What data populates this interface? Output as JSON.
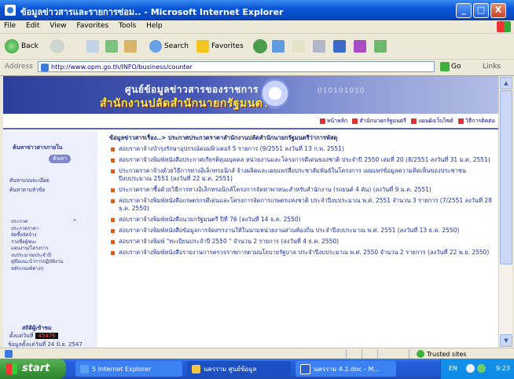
{
  "window": {
    "title": "ข้อมูลข่าวสารและรายการซ่อม.. - Microsoft Internet Explorer",
    "controls": [
      "_",
      "□",
      "X"
    ]
  },
  "menu": [
    "File",
    "Edit",
    "View",
    "Favorites",
    "Tools",
    "Help"
  ],
  "toolbar": {
    "back": "Back",
    "search": "Search",
    "favorites": "Favorites"
  },
  "address": {
    "label": "Address",
    "url": "http://www.opm.go.th/INFO/business/counter",
    "go": "Go",
    "links": "Links"
  },
  "banner": {
    "org_line1": "ศูนย์ข้อมูลข่าวสารของราชการ",
    "org_line2": "สำนักงานปลัดสำนักนายกรัฐมนตรี",
    "decor_text": "010101010"
  },
  "nav_links": [
    "หน้าหลัก",
    "สำนักนายกรัฐมนตรี",
    "แผนผังเว็บไซต์",
    "วิธีการติดต่อ"
  ],
  "sidebar": {
    "search_title": "ค้นหาข่าวสารภายใน",
    "search_button": "ค้นหา",
    "link1": "ค้นหาแบบละเอียด",
    "link2": "ค้นหาตามหัวข้อ",
    "menu": [
      "ประกาศ",
      "ประกวดราคา",
      "จัดซื้อจัดจ้าง",
      "รายชื่อผู้ชนะ",
      "แผนงาน/โครงการ",
      "งบประมาณประจำปี",
      "คู่มือแนะนำการปฏิบัติงาน",
      "หลักเกณฑ์ต่างๆ"
    ],
    "counter_title": "สถิติผู้เข้าชม",
    "counter_label": "ตั้งแต่วันที่",
    "counter_value": "45476",
    "updated": "ข้อมูลตั้งแต่วันที่ 24 มิ.ย. 2547"
  },
  "content": {
    "breadcrumb": "ข้อมูลข่าวสารเรื่อง..> ประกาศประกวดราคาสำนักงานปลัดสำนักนายกรัฐมนตรีว่าการพัสดุ",
    "items": [
      "สอบราคาจ้างบำรุงรักษาอุปกรณ์คอมพิวเตอร์ 5 รายการ (9/2551 ลงวันที่ 13 ก.พ. 2551)",
      "สอบราคาจ้างพิมพ์หนังสือประกาศเกียรติคุณบุคคล หน่วยงานและโครงการดีเด่นของชาติ ประจำปี 2550 เล่มที่ 20 (8/2551 ลงวันที่ 31 ม.ค. 2551)",
      "ประกวดราคาจ้างด้วยวิธีการทางอิเล็กทรอนิกส์ จ้างผลิตและเผยแพร่สื่อประชาสัมพันธ์ในโครงการ เผยแพร่ข้อมูลความคิดเห็นของประชาชน ปีงบประมาณ 2551 (ลงวันที่ 22 ม.ค. 2551)",
      "ประกวดราคาซื้อด้วยวิธีการทางอิเล็กทรอนิกส์โครงการจัดหาพาหนะสำหรับสำนักงาน (รถยนต์ 4 คัน) (ลงวันที่ 9 ม.ค. 2551)",
      "สอบราคาจ้างพิมพ์หนังสือเกษตรกรดีเด่นและโครงการจัดการเกษตรแห่งชาติ ประจำปีงบประมาณ พ.ศ. 2551 จำนวน 3 รายการ (7/2551 ลงวันที่ 28 ธ.ค. 2550)",
      "สอบราคาจ้างพิมพ์หนังสือนายกรัฐมนตรี ปีที่ 76 (ลงวันที่ 14 ธ.ค. 2550)",
      "สอบราคาจ้างพิมพ์หนังสือข้อมูลการจัดสรรงานให้ในนามหน่วยงานส่วนท้องถิ่น ประจำปีงบประมาณ พ.ศ. 2551 (ลงวันที่ 13 ธ.ค. 2550)",
      "สอบราคาจ้างพิมพ์ \"ทะเบียนประจำปี 2550 \" จำนวน 2 รายการ (ลงวันที่ 4 ธ.ค. 2550)",
      "สอบราคาจ้างพิมพ์หนังสือรายงานการตรวจราชการตามนโยบายรัฐบาล ประจำปีงบประมาณ พ.ศ. 2550 จำนวน 2 รายการ (ลงวันที่ 22 พ.ย. 2550)"
    ]
  },
  "status": {
    "zone": "Trusted sites"
  },
  "taskbar": {
    "start": "start",
    "tasks": [
      "5 Internet Explorer",
      "นครราม ศูนย์ข้อมูล",
      "นครราม 4.2.doc - M..."
    ],
    "lang": "EN",
    "clock": "9:23"
  }
}
